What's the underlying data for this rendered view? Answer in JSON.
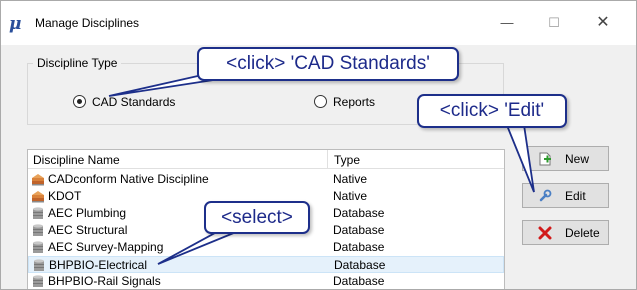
{
  "window": {
    "title": "Manage Disciplines",
    "icon": "mu-logo-icon"
  },
  "discipline_type": {
    "group_label": "Discipline Type",
    "options": [
      {
        "label": "CAD Standards",
        "checked": true
      },
      {
        "label": "Reports",
        "checked": false
      }
    ]
  },
  "list": {
    "columns": [
      "Discipline Name",
      "Type"
    ],
    "rows": [
      {
        "name": "CADconform Native Discipline",
        "type": "Native",
        "icon": "books-icon",
        "selected": false
      },
      {
        "name": "KDOT",
        "type": "Native",
        "icon": "books-icon",
        "selected": false
      },
      {
        "name": "AEC Plumbing",
        "type": "Database",
        "icon": "database-icon",
        "selected": false
      },
      {
        "name": "AEC Structural",
        "type": "Database",
        "icon": "database-icon",
        "selected": false
      },
      {
        "name": "AEC Survey-Mapping",
        "type": "Database",
        "icon": "database-icon",
        "selected": false
      },
      {
        "name": "BHPBIO-Electrical",
        "type": "Database",
        "icon": "database-icon",
        "selected": true
      },
      {
        "name": "BHPBIO-Rail Signals",
        "type": "Database",
        "icon": "database-icon",
        "selected": false
      }
    ]
  },
  "buttons": {
    "new": "New",
    "edit": "Edit",
    "delete": "Delete"
  },
  "callouts": {
    "cad": "<click> 'CAD Standards'",
    "edit": "<click> 'Edit'",
    "select": "<select>"
  },
  "colors": {
    "callout_border": "#1d2f8a",
    "selection": "#e5f1fb"
  }
}
